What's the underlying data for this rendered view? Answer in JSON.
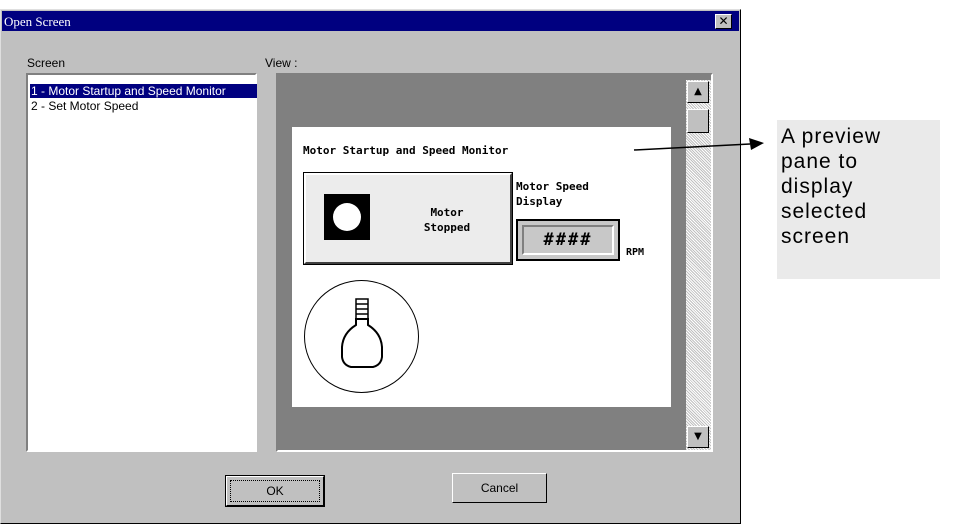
{
  "dialog": {
    "title": "Open Screen",
    "close_glyph": "✕",
    "screen_label": "Screen",
    "view_label": "View :",
    "ok_label": "OK",
    "cancel_label": "Cancel"
  },
  "screens": [
    {
      "label": "1 - Motor Startup and Speed Monitor",
      "selected": true
    },
    {
      "label": "2 - Set Motor Speed",
      "selected": false
    }
  ],
  "scrollbar": {
    "up_glyph": "▲",
    "down_glyph": "▼"
  },
  "preview": {
    "title": "Motor Startup and Speed Monitor",
    "motor_status_line1": "Motor",
    "motor_status_line2": "Stopped",
    "speed_label_line1": "Motor Speed",
    "speed_label_line2": "Display",
    "speed_value": "####",
    "speed_unit": "RPM"
  },
  "annotation": {
    "lines": [
      "A preview",
      "pane to",
      "display",
      "selected",
      "screen"
    ]
  },
  "colors": {
    "title_bar": "#000080",
    "selection": "#000080",
    "dialog_face": "#c0c0c0",
    "view_background": "#808080"
  }
}
